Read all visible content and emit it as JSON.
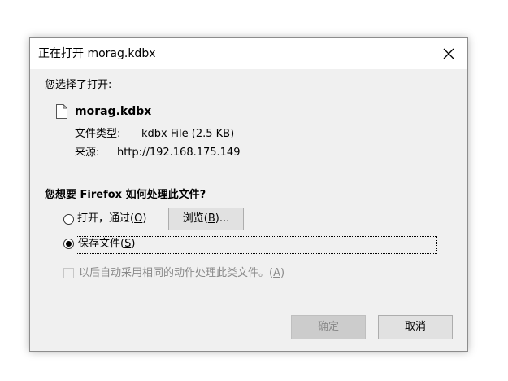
{
  "dialog": {
    "title": "正在打开 morag.kdbx",
    "close_icon": "close-icon"
  },
  "info": {
    "intro": "您选择了打开:",
    "file_icon": "document-icon",
    "filename": "morag.kdbx",
    "type_label": "文件类型:",
    "type_value": "kdbx File (2.5 KB)",
    "source_label": "来源:",
    "source_value": "http://192.168.175.149"
  },
  "question": "您想要 Firefox 如何处理此文件?",
  "options": {
    "open_with": {
      "label_prefix": "打开，通过(",
      "accel": "O",
      "label_suffix": ")",
      "selected": false,
      "browse_prefix": "浏览(",
      "browse_accel": "B",
      "browse_suffix": ")..."
    },
    "save_file": {
      "label_prefix": "保存文件(",
      "accel": "S",
      "label_suffix": ")",
      "selected": true
    },
    "remember": {
      "label_prefix": "以后自动采用相同的动作处理此类文件。(",
      "accel": "A",
      "label_suffix": ")",
      "checked": false,
      "enabled": false
    }
  },
  "buttons": {
    "ok": "确定",
    "ok_enabled": false,
    "cancel": "取消"
  },
  "colors": {
    "dialog_bg": "#f0f0f0",
    "titlebar_bg": "#ffffff",
    "button_bg": "#e1e1e1",
    "disabled_text": "#8a8a8a"
  }
}
